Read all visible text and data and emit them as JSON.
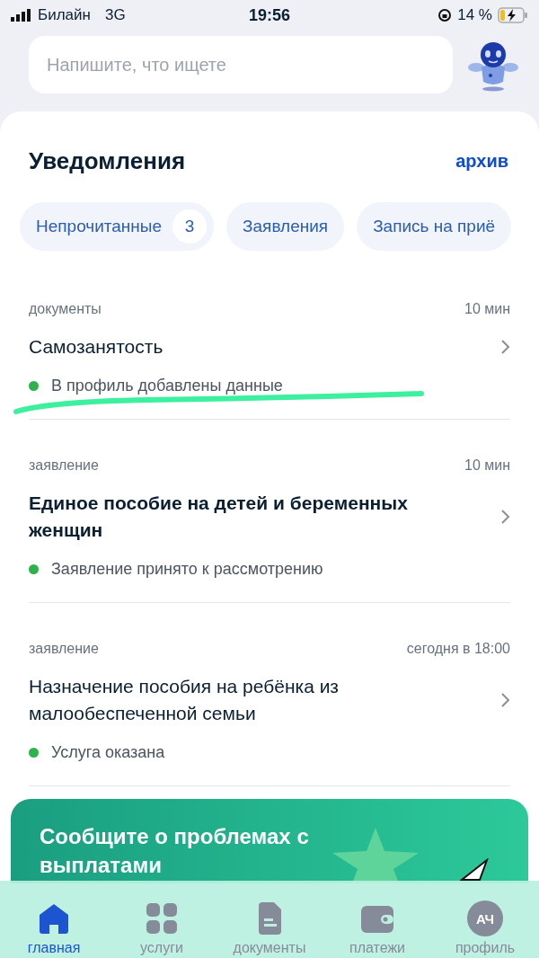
{
  "status_bar": {
    "carrier": "Билайн",
    "network": "3G",
    "time": "19:56",
    "battery": "14 %"
  },
  "search": {
    "placeholder": "Напишите, что ищете"
  },
  "notifications": {
    "title": "Уведомления",
    "archive": "архив",
    "filters": [
      {
        "label": "Непрочитанные",
        "count": "3",
        "selected": false
      },
      {
        "label": "Заявления",
        "selected": false
      },
      {
        "label": "Запись на приё",
        "selected": false
      }
    ],
    "items": [
      {
        "category": "документы",
        "time": "10 мин",
        "title": "Самозанятость",
        "unread": false,
        "status": "В профиль добавлены данные",
        "color": "#2fb24c",
        "highlighted": true
      },
      {
        "category": "заявление",
        "time": "10 мин",
        "title": "Единое пособие на детей и беременных женщин",
        "unread": true,
        "status": "Заявление принято к рассмотрению",
        "color": "#2fb24c",
        "highlighted": false
      },
      {
        "category": "заявление",
        "time": "сегодня в 18:00",
        "title": "Назначение пособия на ребёнка из малообеспеченной семьи",
        "unread": false,
        "status": "Услуга оказана",
        "color": "#2fb24c",
        "highlighted": false
      }
    ]
  },
  "banner": {
    "text": "Сообщите о проблемах с выплатами"
  },
  "nav": [
    {
      "kind": "home",
      "label": "главная",
      "selected": true
    },
    {
      "kind": "services",
      "label": "услуги",
      "selected": false
    },
    {
      "kind": "documents",
      "label": "документы",
      "selected": false
    },
    {
      "kind": "payments",
      "label": "платежи",
      "selected": false
    },
    {
      "kind": "profile",
      "label": "профиль",
      "initials": "АЧ",
      "selected": false
    }
  ]
}
